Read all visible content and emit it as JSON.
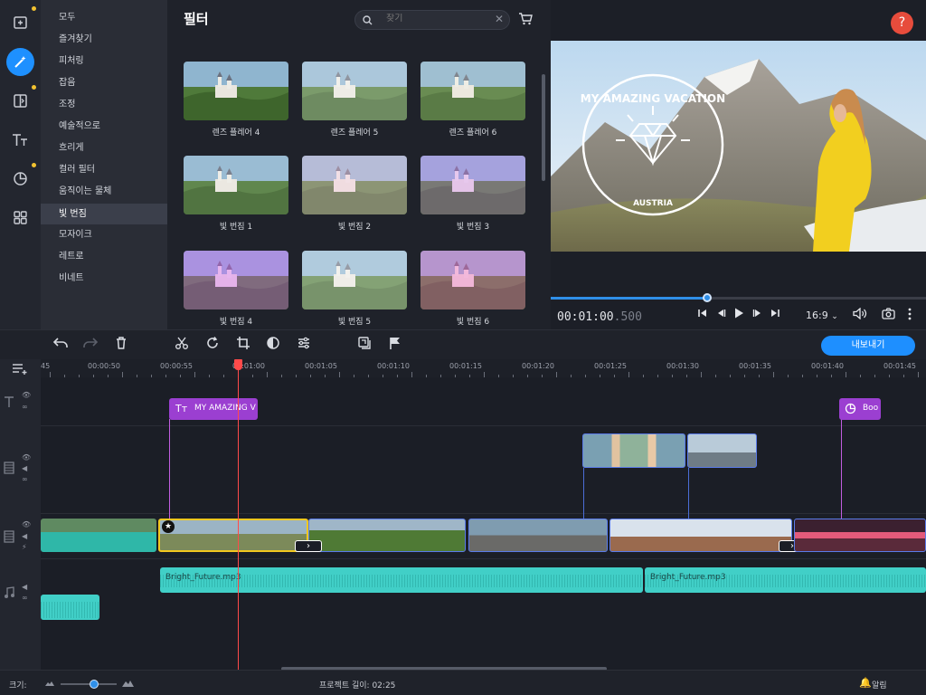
{
  "rail": {
    "items": [
      {
        "icon": "add-media-icon",
        "badge": true
      },
      {
        "icon": "magic-wand-icon",
        "active": true
      },
      {
        "icon": "transitions-icon",
        "badge": true
      },
      {
        "icon": "titles-icon"
      },
      {
        "icon": "stickers-icon",
        "badge": true
      },
      {
        "icon": "more-grid-icon"
      }
    ]
  },
  "categories": {
    "items": [
      "모두",
      "즐겨찾기",
      "피처링",
      "잡음",
      "조정",
      "예술적으로",
      "흐리게",
      "컬러 필터",
      "움직이는 물체",
      "빛 번짐",
      "모자이크",
      "레트로",
      "비네트"
    ],
    "selected": "빛 번짐"
  },
  "browser": {
    "title": "필터",
    "search_placeholder": "찾기",
    "thumbs": [
      {
        "label": "렌즈 플레어 4",
        "tint": "rgba(255,255,255,0.0)"
      },
      {
        "label": "렌즈 플레어 5",
        "tint": "rgba(255,255,255,0.25)"
      },
      {
        "label": "렌즈 플레어 6",
        "tint": "rgba(255,250,220,0.15)"
      },
      {
        "label": "빛 번짐 1",
        "tint": "rgba(255,255,255,0.1)"
      },
      {
        "label": "빛 번짐 2",
        "tint": "rgba(255,200,230,0.35)"
      },
      {
        "label": "빛 번짐 3",
        "tint": "rgba(220,120,255,0.3)"
      },
      {
        "label": "빛 번짐 4",
        "tint": "rgba(220,80,255,0.35)"
      },
      {
        "label": "빛 번짐 5",
        "tint": "rgba(255,255,255,0.3)"
      },
      {
        "label": "빛 번짐 6",
        "tint": "rgba(255,90,200,0.35)"
      }
    ]
  },
  "preview": {
    "help_label": "?",
    "overlay_title": "MY AMAZING VACATION",
    "overlay_subtitle": "AUSTRIA",
    "timecode_main": "00:01:00",
    "timecode_ms": ".500",
    "progress_fraction": 0.42,
    "aspect_ratio": "16:9",
    "aspect_chevron": "⌄"
  },
  "toolbar": {
    "export_label": "내보내기"
  },
  "ruler": {
    "ticks": [
      "45",
      "00:00:50",
      "00:00:55",
      "00:01:00",
      "00:01:05",
      "00:01:10",
      "00:01:15",
      "00:01:20",
      "00:01:25",
      "00:01:30",
      "00:01:35",
      "00:01:40",
      "00:01:45"
    ]
  },
  "timeline": {
    "title_clip_1": "MY AMAZING V",
    "title_clip_2": "Boo",
    "audio_clip_1": "Bright_Future.mp3",
    "audio_clip_2": "Bright_Future.mp3"
  },
  "status": {
    "size_label": "크기:",
    "project_length_label": "프로젝트 길이:",
    "project_length_value": "02:25",
    "notifications_label": "알림"
  },
  "colors": {
    "accent": "#1e8fff",
    "playhead": "#ff4a4a",
    "audio": "#41cfc7",
    "title_clip": "#9b3fd1",
    "help": "#e74c3c",
    "badge": "#f2c230"
  }
}
